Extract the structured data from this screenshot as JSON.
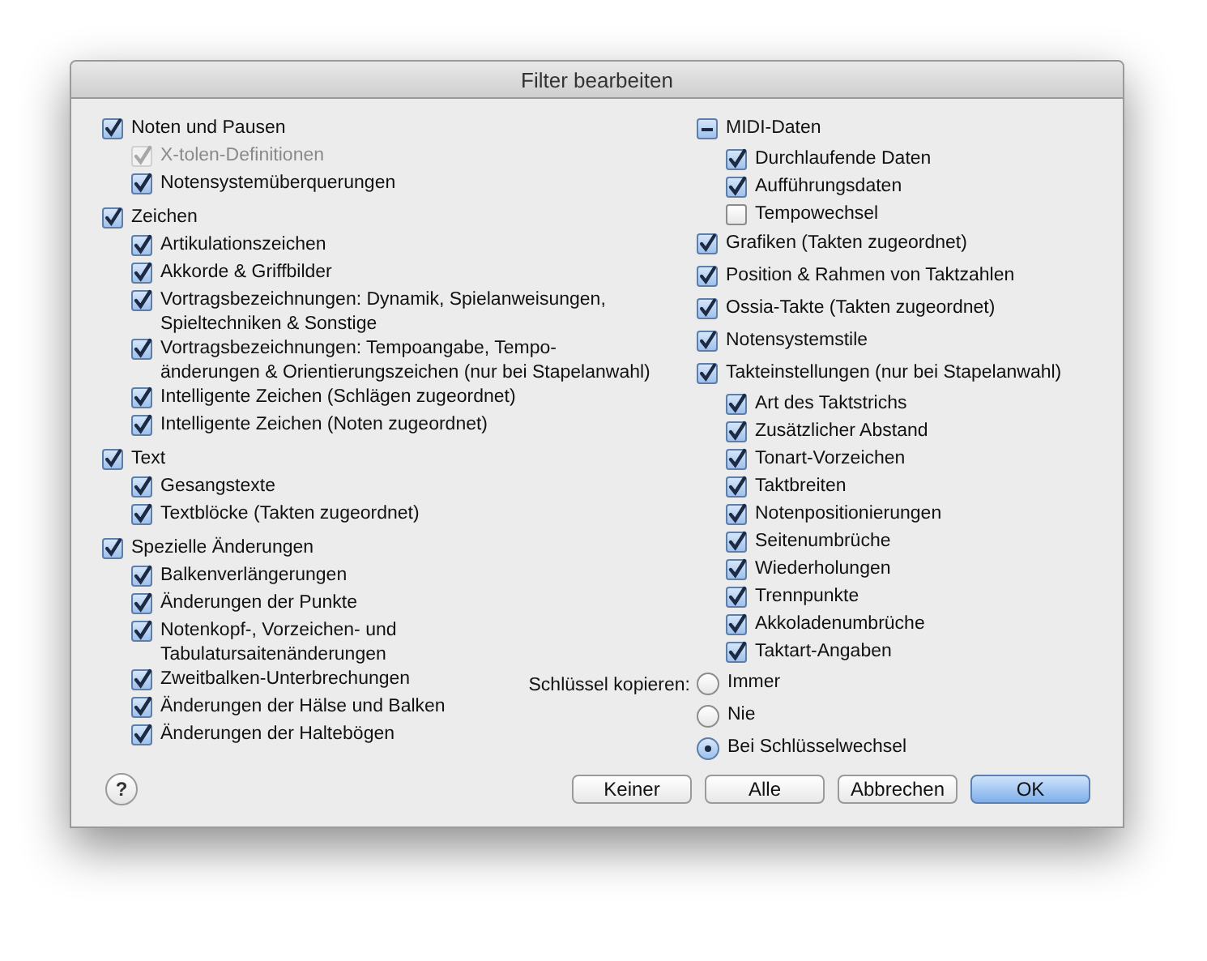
{
  "window": {
    "title": "Filter bearbeiten"
  },
  "left_column": [
    {
      "label": "Noten und Pausen",
      "checked": true,
      "mixed": false,
      "children": [
        {
          "label": "X-tolen-Definitionen",
          "checked": true,
          "disabled": true
        },
        {
          "label": "Notensystemüberquerungen",
          "checked": true,
          "disabled": false
        }
      ]
    },
    {
      "label": "Zeichen",
      "checked": true,
      "mixed": false,
      "children": [
        {
          "label": "Artikulationszeichen",
          "checked": true,
          "disabled": false
        },
        {
          "label": "Akkorde & Griffbilder",
          "checked": true,
          "disabled": false
        },
        {
          "label": "Vortragsbezeichnungen: Dynamik, Spielanweisungen,\nSpieltechniken & Sonstige",
          "checked": true,
          "disabled": false
        },
        {
          "label": "Vortragsbezeichnungen: Tempoangabe, Tempo-\nänderungen & Orientierungszeichen (nur bei Stapelanwahl)",
          "checked": true,
          "disabled": false
        },
        {
          "label": "Intelligente Zeichen (Schlägen zugeordnet)",
          "checked": true,
          "disabled": false
        },
        {
          "label": "Intelligente Zeichen (Noten zugeordnet)",
          "checked": true,
          "disabled": false
        }
      ]
    },
    {
      "label": "Text",
      "checked": true,
      "mixed": false,
      "children": [
        {
          "label": "Gesangstexte",
          "checked": true,
          "disabled": false
        },
        {
          "label": "Textblöcke (Takten zugeordnet)",
          "checked": true,
          "disabled": false
        }
      ]
    },
    {
      "label": "Spezielle Änderungen",
      "checked": true,
      "mixed": false,
      "children": [
        {
          "label": "Balkenverlängerungen",
          "checked": true,
          "disabled": false
        },
        {
          "label": "Änderungen der Punkte",
          "checked": true,
          "disabled": false
        },
        {
          "label": "Notenkopf-, Vorzeichen- und\nTabulatursaitenänderungen",
          "checked": true,
          "disabled": false
        },
        {
          "label": "Zweitbalken-Unterbrechungen",
          "checked": true,
          "disabled": false
        },
        {
          "label": "Änderungen der Hälse und Balken",
          "checked": true,
          "disabled": false
        },
        {
          "label": "Änderungen der Haltebögen",
          "checked": true,
          "disabled": false
        }
      ]
    }
  ],
  "right_column": [
    {
      "label": "MIDI-Daten",
      "checked": true,
      "mixed": true,
      "children": [
        {
          "label": "Durchlaufende Daten",
          "checked": true,
          "disabled": false
        },
        {
          "label": "Aufführungsdaten",
          "checked": true,
          "disabled": false
        },
        {
          "label": "Tempowechsel",
          "checked": false,
          "disabled": false
        }
      ]
    },
    {
      "label": "Grafiken (Takten zugeordnet)",
      "checked": true,
      "mixed": false
    },
    {
      "label": "Position & Rahmen von Taktzahlen",
      "checked": true,
      "mixed": false
    },
    {
      "label": "Ossia-Takte (Takten zugeordnet)",
      "checked": true,
      "mixed": false
    },
    {
      "label": "Notensystemstile",
      "checked": true,
      "mixed": false
    },
    {
      "label": "Takteinstellungen (nur bei Stapelanwahl)",
      "checked": true,
      "mixed": false,
      "children": [
        {
          "label": "Art des Taktstrichs",
          "checked": true,
          "disabled": false
        },
        {
          "label": "Zusätzlicher Abstand",
          "checked": true,
          "disabled": false
        },
        {
          "label": "Tonart-Vorzeichen",
          "checked": true,
          "disabled": false
        },
        {
          "label": "Taktbreiten",
          "checked": true,
          "disabled": false
        },
        {
          "label": "Notenpositionierungen",
          "checked": true,
          "disabled": false
        },
        {
          "label": "Seitenumbrüche",
          "checked": true,
          "disabled": false
        },
        {
          "label": "Wiederholungen",
          "checked": true,
          "disabled": false
        },
        {
          "label": "Trennpunkte",
          "checked": true,
          "disabled": false
        },
        {
          "label": "Akkoladenumbrüche",
          "checked": true,
          "disabled": false
        },
        {
          "label": "Taktart-Angaben",
          "checked": true,
          "disabled": false
        }
      ]
    }
  ],
  "clef_copy": {
    "label": "Schlüssel kopieren:",
    "options": [
      {
        "label": "Immer",
        "selected": false
      },
      {
        "label": "Nie",
        "selected": false
      },
      {
        "label": "Bei Schlüsselwechsel",
        "selected": true
      }
    ]
  },
  "help": "?",
  "buttons": [
    {
      "label": "Keiner",
      "default": false
    },
    {
      "label": "Alle",
      "default": false
    },
    {
      "label": "Abbrechen",
      "default": false
    },
    {
      "label": "OK",
      "default": true
    }
  ]
}
